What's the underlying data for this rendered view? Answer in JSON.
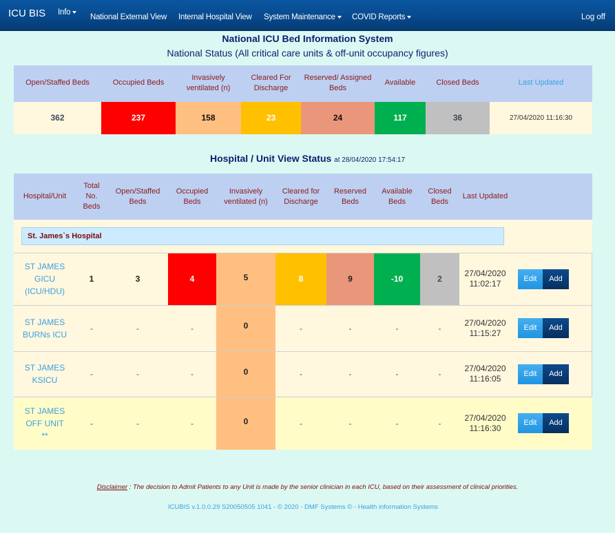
{
  "navbar": {
    "brand": "ICU BIS",
    "items": [
      {
        "label": "Info",
        "dropdown": true
      },
      {
        "label": "National External View",
        "dropdown": false
      },
      {
        "label": "Internal Hospital View",
        "dropdown": false
      },
      {
        "label": "System Maintenance",
        "dropdown": true
      },
      {
        "label": "COVID Reports",
        "dropdown": true
      }
    ],
    "logoff": "Log off"
  },
  "header": {
    "title": "National ICU Bed Information System",
    "subtitle": "National Status (All critical care units & off-unit occupancy figures)"
  },
  "national": {
    "headers": [
      "Open/Staffed Beds",
      "Occupied Beds",
      "Invasively ventilated (n)",
      "Cleared For Discharge",
      "Reserved/ Assigned Beds",
      "Available",
      "Closed Beds",
      "Last Updated"
    ],
    "values": {
      "open_staffed": "362",
      "occupied": "237",
      "ventilated": "158",
      "cleared": "23",
      "reserved": "24",
      "available": "117",
      "closed": "36",
      "last_updated": "27/04/2020 11:16:30"
    }
  },
  "hospital_view": {
    "title": "Hospital / Unit View Status",
    "at": "at 28/04/2020 17:54:17",
    "headers": [
      "Hospital/Unit",
      "Total No. Beds",
      "Open/Staffed Beds",
      "Occupied Beds",
      "Invasively ventilated (n)",
      "Cleared for Discharge",
      "Reserved Beds",
      "Available Beds",
      "Closed Beds",
      "Last Updated"
    ],
    "hospital_name": "St. James`s Hospital",
    "edit_label": "Edit",
    "add_label": "Add",
    "units": [
      {
        "name_lines": [
          "ST JAMES",
          "GICU",
          "(ICU/HDU)"
        ],
        "total": "1",
        "open": "3",
        "occupied": "4",
        "ventilated": "5",
        "cleared": "8",
        "reserved": "9",
        "available": "-10",
        "closed": "2",
        "date": "27/04/2020",
        "time": "11:02:17"
      },
      {
        "name_lines": [
          "ST JAMES",
          "BURNs ICU",
          ""
        ],
        "total": "-",
        "open": "-",
        "occupied": "-",
        "ventilated": "0",
        "cleared": "-",
        "reserved": "-",
        "available": "-",
        "closed": "-",
        "date": "27/04/2020",
        "time": "11:15:27"
      },
      {
        "name_lines": [
          "ST JAMES",
          "KSICU",
          ""
        ],
        "total": "-",
        "open": "-",
        "occupied": "-",
        "ventilated": "0",
        "cleared": "-",
        "reserved": "-",
        "available": "-",
        "closed": "-",
        "date": "27/04/2020",
        "time": "11:16:05"
      },
      {
        "name_lines": [
          "ST JAMES",
          "OFF UNIT",
          "**"
        ],
        "total": "-",
        "open": "-",
        "occupied": "-",
        "ventilated": "0",
        "cleared": "-",
        "reserved": "-",
        "available": "-",
        "closed": "-",
        "date": "27/04/2020",
        "time": "11:16:30"
      }
    ]
  },
  "footer": {
    "disclaimer_label": "Disclaimer",
    "disclaimer_text": " : The decision to Admit Patients to any Unit is made by the senior clinician in each ICU, based on their assessment of clinical priorities.",
    "version": "ICUBIS v.1.0.0.29  S20050505 1041 - © 2020 - DMF Systems © - Health information Systems"
  },
  "colors": {
    "occupied": "#ff0000",
    "ventilated": "#ffbf80",
    "cleared": "#ffc000",
    "reserved": "#ea967a",
    "available": "#00b050",
    "closed": "#c0c0c0",
    "navbar": "#084a8e",
    "background": "#dcf8f3"
  }
}
